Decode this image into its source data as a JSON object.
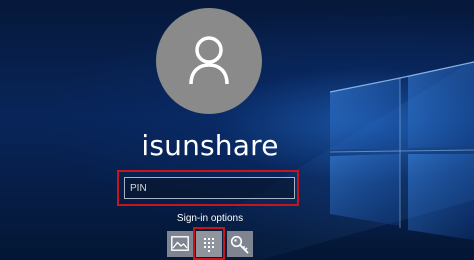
{
  "lock_screen": {
    "username": "isunshare",
    "pin_field": {
      "value": "",
      "placeholder": "PIN"
    },
    "sign_in_options_label": "Sign-in options",
    "sign_in_options": [
      {
        "name": "Picture password",
        "icon": "picture-icon"
      },
      {
        "name": "PIN",
        "icon": "keypad-icon",
        "selected": true
      },
      {
        "name": "Password",
        "icon": "key-icon"
      }
    ]
  },
  "colors": {
    "highlight": "#c4161c",
    "avatar": "#8a8a8a",
    "background": "#06183a"
  }
}
